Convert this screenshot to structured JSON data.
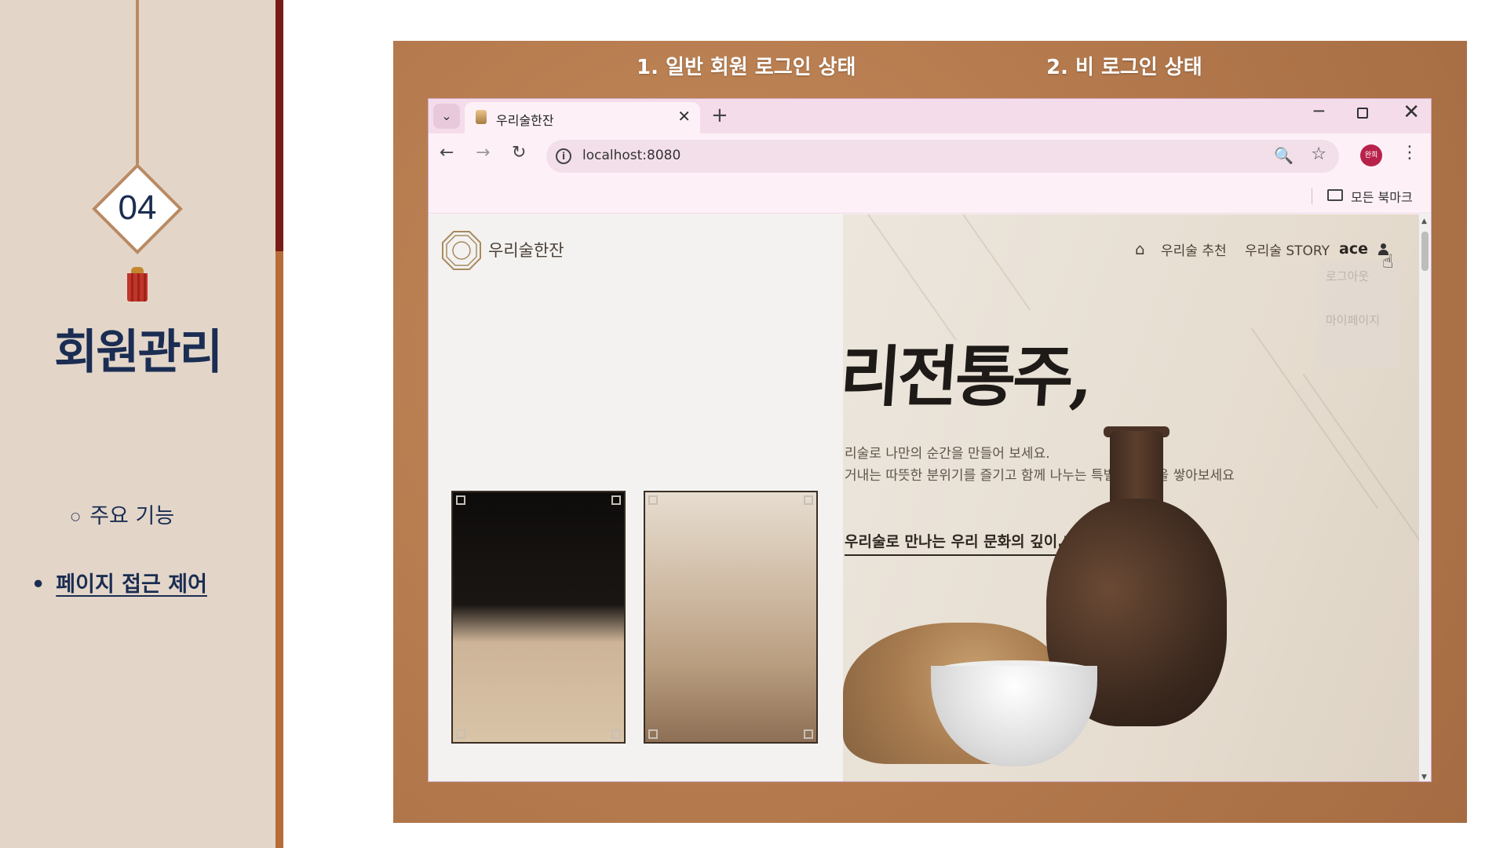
{
  "slide": {
    "section_number": "04",
    "section_title": "회원관리",
    "menu": [
      {
        "label": "주요 기능",
        "active": false
      },
      {
        "label": "페이지 접근 제어",
        "active": true
      }
    ],
    "captions": [
      "1. 일반 회원 로그인 상태",
      "2. 비 로그인 상태"
    ],
    "colors": {
      "navy": "#1b2d52",
      "panel": "#e3d6c9",
      "accent": "#b86d38",
      "accent_dark": "#7a1c16",
      "kraft": "#b67c4f"
    }
  },
  "browser": {
    "tab_title": "우리술한잔",
    "tab_close": "✕",
    "new_tab": "+",
    "url": "localhost:8080",
    "bookmarks_label": "모든 북마크",
    "profile_label": "완희",
    "icons": [
      "tab-menu-icon",
      "back-icon",
      "forward-icon",
      "reload-icon",
      "info-icon",
      "zoom-icon",
      "star-icon",
      "kebab-icon",
      "folder-icon",
      "minimize-icon",
      "maximize-icon",
      "close-icon"
    ]
  },
  "site": {
    "name": "우리술한잔",
    "nav": [
      "우리술 추천",
      "우리술 STORY"
    ],
    "username": "ace",
    "dropdown": [
      "로그아웃",
      "마이페이지"
    ],
    "hero_title": "리전통주,",
    "hero_lines": [
      "리술로 나만의 순간을 만들어 보세요.",
      "거내는 따뜻한 분위기를 즐기고 함께 나누는 특별한 경험을 쌓아보세요"
    ],
    "hero_quote": "우리술로 만나는 우리 문화의 깊이.\""
  }
}
